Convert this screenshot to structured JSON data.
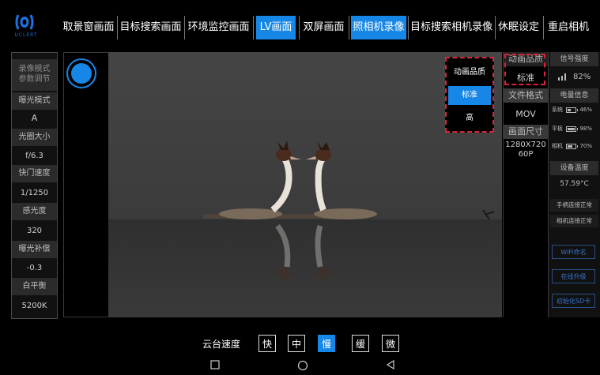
{
  "nav": {
    "logo_text": "UCLERT",
    "tabs": [
      {
        "label": "取景窗画面"
      },
      {
        "label": "目标搜索画面"
      },
      {
        "label": "环境监控画面"
      },
      {
        "label": "LV画面"
      },
      {
        "label": "双屏画面"
      },
      {
        "label": "照相机录像"
      },
      {
        "label": "目标搜索相机录像"
      },
      {
        "label": "休眠设定"
      },
      {
        "label": "重启相机"
      }
    ],
    "active_tab_indices": [
      3,
      5
    ],
    "accent_color": "#1687e6"
  },
  "left_panel": {
    "heading": "录像模式参数调节",
    "items": [
      {
        "label": "曝光模式",
        "value": "A"
      },
      {
        "label": "光圈大小",
        "value": "f/6.3"
      },
      {
        "label": "快门速度",
        "value": "1/1250"
      },
      {
        "label": "感光度",
        "value": "320"
      },
      {
        "label": "曝光补偿",
        "value": "-0.3"
      },
      {
        "label": "白平衡",
        "value": "5200K"
      }
    ]
  },
  "quality_dropdown": {
    "options": [
      "动画品质",
      "标准",
      "高"
    ],
    "selected": "标准"
  },
  "right_col": {
    "quality_label": "动画品质",
    "quality_value": "标准",
    "format_label": "文件格式",
    "format_value": "MOV",
    "size_label": "画面尺寸",
    "size_value_line1": "1280X720",
    "size_value_line2": "60P"
  },
  "status_col": {
    "signal_label": "信号强度",
    "signal_value": "82%",
    "battery_label": "电量信息",
    "batteries": [
      {
        "name": "系统",
        "value": "46%",
        "level": 0.46
      },
      {
        "name": "平板",
        "value": "98%",
        "level": 0.98
      },
      {
        "name": "相机",
        "value": "70%",
        "level": 0.7
      }
    ],
    "temp_label": "设备温度",
    "temp_value": "57.59°C",
    "handle_status": "手柄连接正常",
    "camera_status": "相机连接正常",
    "buttons": [
      "WiFi命名",
      "在线升级",
      "初始化SD卡"
    ]
  },
  "ptz": {
    "label": "云台速度",
    "options": [
      "快",
      "中",
      "慢",
      "缓",
      "微"
    ],
    "selected": "慢"
  },
  "system_nav": {
    "icons": [
      "square-icon",
      "circle-icon",
      "back-triangle-icon"
    ]
  }
}
